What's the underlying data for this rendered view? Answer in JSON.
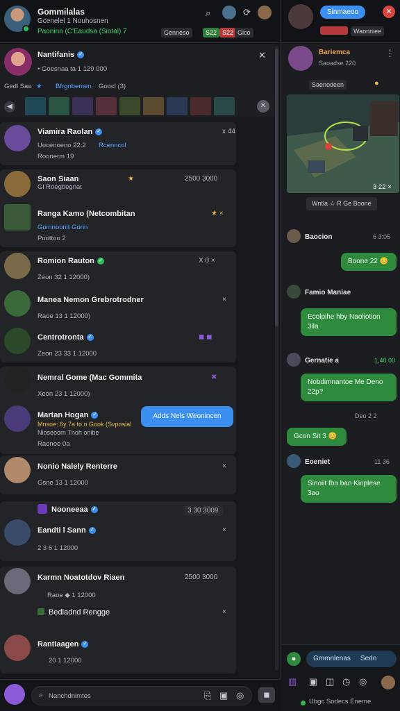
{
  "header": {
    "app_title": "Gommilalas",
    "subtitle": "Gcenelel 1 Nouhosnen",
    "status_line": "Paoninn (C'Eaudsa (Siotal) 7",
    "status_icons": [
      "search-icon",
      "avatar-icon",
      "share-icon",
      "avatar-icon"
    ],
    "chips": [
      {
        "label": "Genneso",
        "color": "#2a2c31"
      },
      {
        "label": "S22",
        "color": "#2f7d3b"
      },
      {
        "label": "S22",
        "color": "#b63a3a"
      },
      {
        "label": "Gico",
        "color": "#2a2c31"
      }
    ]
  },
  "pinned": {
    "name": "Nantifanis",
    "meta": "• Goesnaa ta 1 129 000",
    "time_label": "Gedl Sao",
    "tag": "Bfrgnbemen",
    "tag2": "Goocl (3)"
  },
  "chats": [
    {
      "name": "Viamira Raolan",
      "line1": "Uocenoeno 22:2",
      "line1b": "Rcenncol",
      "line2": "Roonerm  19",
      "right": "x  44"
    },
    {
      "name": "Saon Siaan",
      "line1": "Gl Roegbegnat",
      "right": "2500  3000",
      "star": "★"
    },
    {
      "name": "Ranga Kamo (Netcombitan",
      "line1": "Gomnoonit Gorin",
      "line2": "Poottoo  2",
      "right": "★  ×"
    },
    {
      "name": "Romion Rauton",
      "line1": "Zeon 32  1 12000)",
      "right": "X  0  ×"
    },
    {
      "name": "Manea Nemon Grebrotrodner",
      "line1": "Raoe 13  1 12000)",
      "right": "×"
    },
    {
      "name": "Centrotronta",
      "line1": "Zeon 23 33  1 12000",
      "right": "◼  ◼"
    },
    {
      "name": "Nemral Gome (Mac Gommita",
      "line1": "Xeon 23  1 12000)",
      "right": "✖"
    },
    {
      "name": "Martan Hogan",
      "line1": "Mnsoe: 6y 7a to o Gook (Svposial",
      "line2": "Nioseoorn Tnoh onibe",
      "line3": "Raonoe 0a",
      "right": ""
    },
    {
      "name": "Nonio Nalely Renterre",
      "line1": "Gsne  13  1 12000",
      "right": "×"
    },
    {
      "name": "Nooneeaa",
      "line1": "",
      "right": "3  30  3009"
    },
    {
      "name": "Eandti l Sann",
      "line1": "2  3 6  1 12000",
      "right": "×"
    },
    {
      "name": "Karmn Noatotdov Riaen",
      "line1": "Raoe  ◆  1 12000",
      "right": "2500  3000"
    },
    {
      "name": "Bedladnd Rengge",
      "line1": "",
      "right": "×"
    },
    {
      "name": "Rantiaagen",
      "line1": "20  1 12000",
      "right": ""
    }
  ],
  "tooltip": "Adds Nels Weonincen",
  "composer": {
    "placeholder": "Nanchdnimtes"
  },
  "right_panel": {
    "title": "Sinmaeoo",
    "dropdown": "Waonniee",
    "profile_name": "Bariemca",
    "profile_meta": "Saoadse 220",
    "image_caption": "Saenodeen",
    "image_footer": "3 22  ×",
    "filter": "Wntla  ☆  R  Ge  Boone",
    "messages": [
      {
        "author": "Baocion",
        "time": "6  3:05",
        "text": ""
      },
      {
        "author": "",
        "time": "",
        "text": "Boone 22  😊"
      },
      {
        "author": "Famio Maniae",
        "time": "",
        "text": "Ecolpihe hby Naoliotion 3ila"
      },
      {
        "author": "Gernatie a",
        "time": "1,40  00",
        "text": "Nobdimnantoe Me Deno 22p?"
      },
      {
        "author": "",
        "time": "Deo 2  2",
        "text": "Gcon Sit 3  😊"
      },
      {
        "author": "Eoeniet",
        "time": "11  36",
        "text": "Sinoiit fbo ban Kinplese 3ao"
      }
    ],
    "reply_label": "Gmmnlenas",
    "reply_btn": "Sedo",
    "footer": "Ubgc Sodecs Eneme"
  }
}
